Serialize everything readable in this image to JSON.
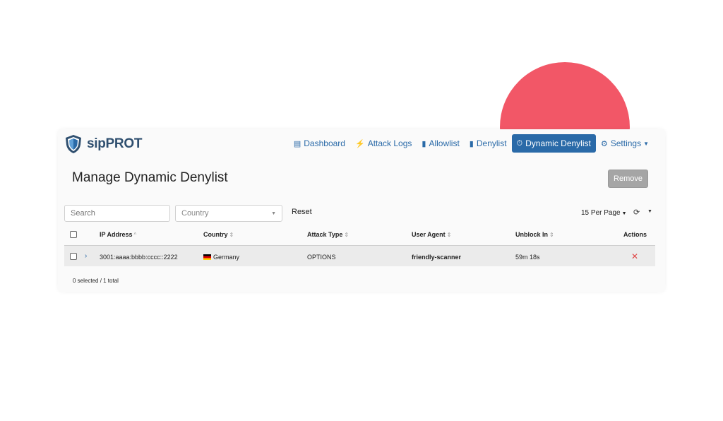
{
  "brand": {
    "name": "sipPROT",
    "logo_icon": "shield-icon"
  },
  "nav": {
    "items": [
      {
        "label": "Dashboard",
        "icon": "dashboard-icon",
        "glyph": "▤"
      },
      {
        "label": "Attack Logs",
        "icon": "lightning-icon",
        "glyph": "⚡"
      },
      {
        "label": "Allowlist",
        "icon": "file-icon",
        "glyph": "▮"
      },
      {
        "label": "Denylist",
        "icon": "file-icon",
        "glyph": "▮"
      },
      {
        "label": "Dynamic Denylist",
        "icon": "stopwatch-icon",
        "glyph": "⏱"
      },
      {
        "label": "Settings",
        "icon": "gear-icon",
        "glyph": "⚙"
      }
    ],
    "active": "Dynamic Denylist"
  },
  "page": {
    "title": "Manage Dynamic Denylist",
    "remove_label": "Remove"
  },
  "filters": {
    "search_placeholder": "Search",
    "country_placeholder": "Country",
    "reset_label": "Reset",
    "per_page_label": "15 Per Page"
  },
  "table": {
    "columns": [
      "IP Address",
      "Country",
      "Attack Type",
      "User Agent",
      "Unblock In",
      "Actions"
    ],
    "rows": [
      {
        "ip": "3001:aaaa:bbbb:cccc::2222",
        "country": "Germany",
        "attack_type": "OPTIONS",
        "user_agent": "friendly-scanner",
        "unblock_in": "59m 18s"
      }
    ]
  },
  "footer": {
    "selection_summary": "0 selected / 1 total"
  },
  "colors": {
    "accent": "#2a6aa8",
    "decoration": "#f25767",
    "danger": "#e04848"
  }
}
